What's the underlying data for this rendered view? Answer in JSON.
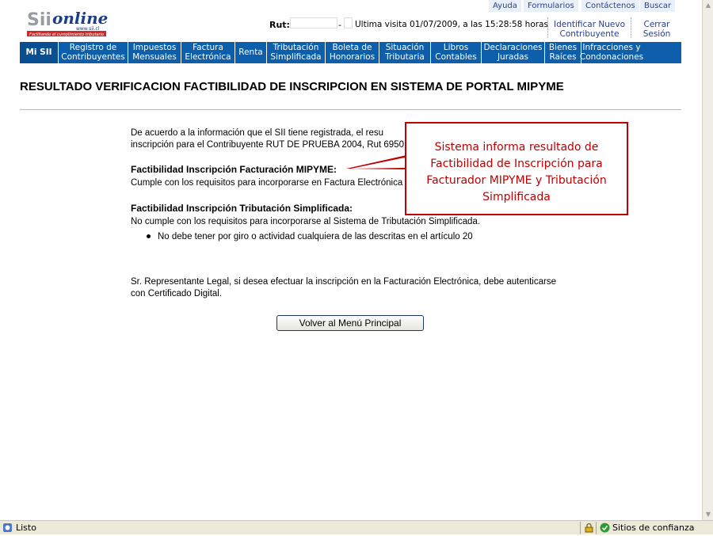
{
  "header": {
    "logo_text": "SII online",
    "logo_url_text": "www.sii.cl",
    "logo_tagline": "Facilitando el cumplimiento tributario",
    "top_links": [
      "Ayuda",
      "Formularios",
      "Contáctenos",
      "Buscar"
    ],
    "rut_label": "Rut:",
    "rut_separator": "-",
    "last_visit": "Ultima visita 01/07/2009, a las 15:28:58 horas",
    "identify_new": "Identificar Nuevo Contribuyente",
    "logout": "Cerrar Sesión"
  },
  "nav": [
    {
      "label": "Mi SII"
    },
    {
      "label": "Registro de Contribuyentes"
    },
    {
      "label": "Impuestos Mensuales"
    },
    {
      "label": "Factura Electrónica"
    },
    {
      "label": "Renta"
    },
    {
      "label": "Tributación Simplificada"
    },
    {
      "label": "Boleta de Honorarios"
    },
    {
      "label": "Situación Tributaria"
    },
    {
      "label": "Libros Contables"
    },
    {
      "label": "Declaraciones Juradas"
    },
    {
      "label": "Bienes Raíces"
    },
    {
      "label": "Infracciones y Condonaciones"
    }
  ],
  "page_title": "RESULTADO VERIFICACION FACTIBILIDAD DE INSCRIPCION EN SISTEMA DE PORTAL MIPYME",
  "intro_line1": "De acuerdo a la información que el SII tiene registrada, el resu",
  "intro_line2": "inscripción para el Contribuyente RUT DE PRUEBA 2004, Rut 6950",
  "section1_title": "Factibilidad Inscripción Facturación MIPYME:",
  "section1_text": "Cumple con los requisitos para incorporarse en Factura Electrónica",
  "section2_title": "Factibilidad Inscripción Tributación Simplificada:",
  "section2_text": "No cumple con los requisitos para incorporarse al Sistema de Tributación Simplificada.",
  "section2_bullet": "No debe tener por giro o actividad cualquiera de las descritas en el artículo 20",
  "legal_line1": "Sr. Representante Legal, si desea efectuar la inscripción en la Facturación Electrónica, debe autenticarse",
  "legal_line2": "con Certificado Digital.",
  "back_button": "Volver al Menú Principal",
  "callout_text": "Sistema informa resultado de Factibilidad de Inscripción para Facturador MIPYME y Tributación Simplificada",
  "status": {
    "left": "Listo",
    "right": "Sitios de confianza"
  },
  "colors": {
    "nav_blue": "#0d5eab",
    "callout_red": "#c00000",
    "link_blue": "#2a3f8f"
  }
}
